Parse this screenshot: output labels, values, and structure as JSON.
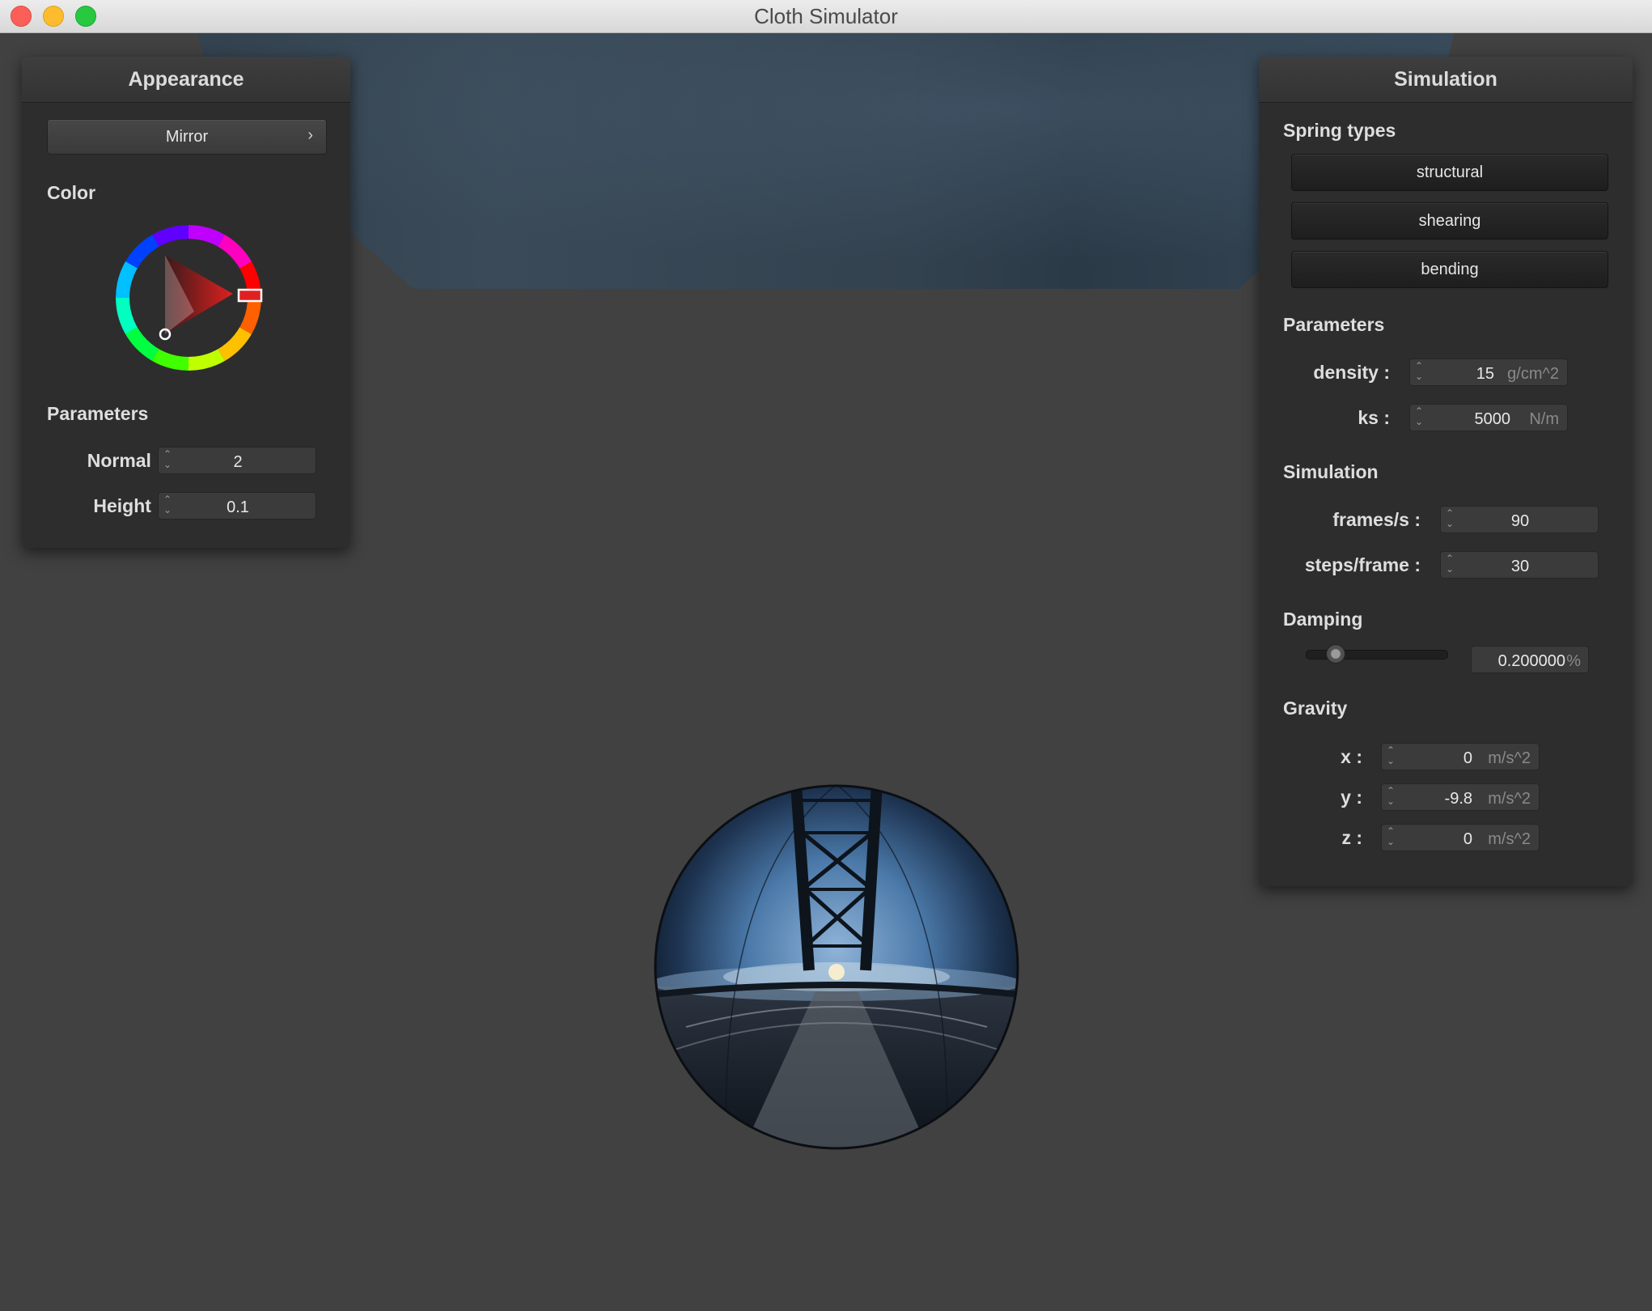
{
  "window": {
    "title": "Cloth Simulator"
  },
  "appearance": {
    "title": "Appearance",
    "shader_button": {
      "label": "Mirror",
      "arrow": "›"
    },
    "color_label": "Color",
    "color": {
      "hue_deg": 0,
      "hex": "#e02020"
    },
    "parameters_label": "Parameters",
    "normal": {
      "label": "Normal :",
      "value": "2"
    },
    "height": {
      "label": "Height :",
      "value": "0.1"
    }
  },
  "simulation": {
    "title": "Simulation",
    "spring_types_label": "Spring types",
    "spring_types": [
      "structural",
      "shearing",
      "bending"
    ],
    "parameters_label": "Parameters",
    "density": {
      "label": "density :",
      "value": "15",
      "unit": "g/cm^2"
    },
    "ks": {
      "label": "ks :",
      "value": "5000",
      "unit": "N/m"
    },
    "simulation_label": "Simulation",
    "frames": {
      "label": "frames/s :",
      "value": "90"
    },
    "steps": {
      "label": "steps/frame :",
      "value": "30"
    },
    "damping_label": "Damping",
    "damping": {
      "value": "0.200000",
      "unit": "%",
      "slider_fraction": 0.2
    },
    "gravity_label": "Gravity",
    "gravity": {
      "x": {
        "label": "x :",
        "value": "0",
        "unit": "m/s^2"
      },
      "y": {
        "label": "y :",
        "value": "-9.8",
        "unit": "m/s^2"
      },
      "z": {
        "label": "z :",
        "value": "0",
        "unit": "m/s^2"
      }
    }
  },
  "icons": {
    "spinner": "spinner-arrows-icon",
    "chevron": "chevron-right-icon"
  }
}
